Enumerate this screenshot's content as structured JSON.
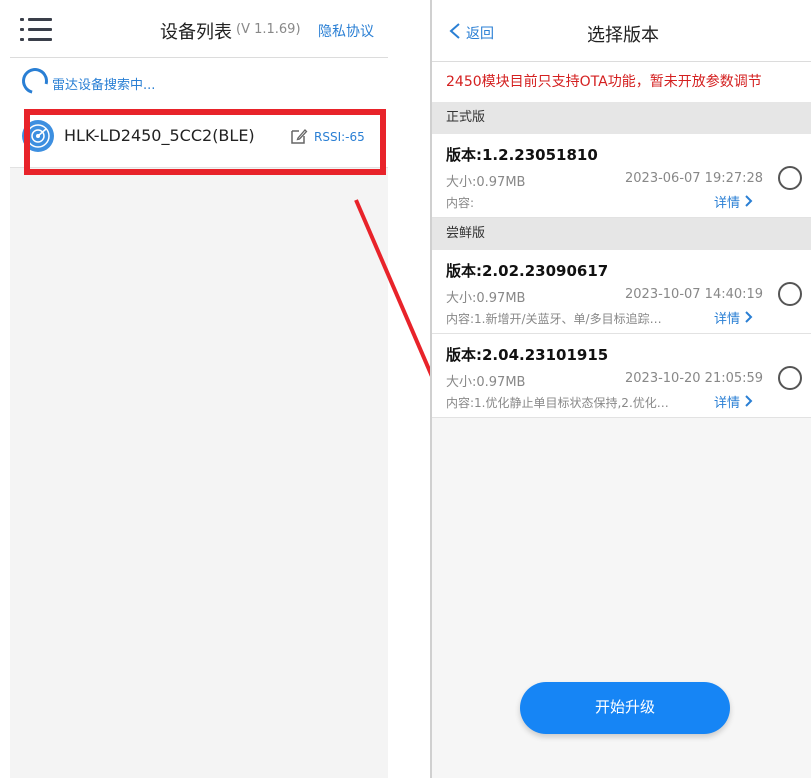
{
  "device_list": {
    "title": "设备列表",
    "version": "(V 1.1.69)",
    "privacy_link": "隐私协议",
    "search_status": "雷达设备搜索中...",
    "devices": [
      {
        "name": "HLK-LD2450_5CC2(BLE)",
        "rssi": "RSSI:-65"
      }
    ]
  },
  "version_select": {
    "back_label": "返回",
    "title": "选择版本",
    "warning": "2450模块目前只支持OTA功能，暂未开放参数调节",
    "sections": [
      {
        "heading": "正式版",
        "items": [
          {
            "version": "版本:1.2.23051810",
            "size": "大小:0.97MB",
            "date": "2023-06-07 19:27:28",
            "content": "内容:",
            "detail": "详情"
          }
        ]
      },
      {
        "heading": "尝鲜版",
        "items": [
          {
            "version": "版本:2.02.23090617",
            "size": "大小:0.97MB",
            "date": "2023-10-07 14:40:19",
            "content": "内容:1.新增开/关蓝牙、单/多目标追踪…",
            "detail": "详情"
          },
          {
            "version": "版本:2.04.23101915",
            "size": "大小:0.97MB",
            "date": "2023-10-20 21:05:59",
            "content": "内容:1.优化静止单目标状态保持,2.优化…",
            "detail": "详情"
          }
        ]
      }
    ],
    "start_button": "开始升级"
  },
  "colors": {
    "accent": "#2a7fd4",
    "button": "#1685f5",
    "warning": "#d42020",
    "highlight": "#e8232a"
  }
}
